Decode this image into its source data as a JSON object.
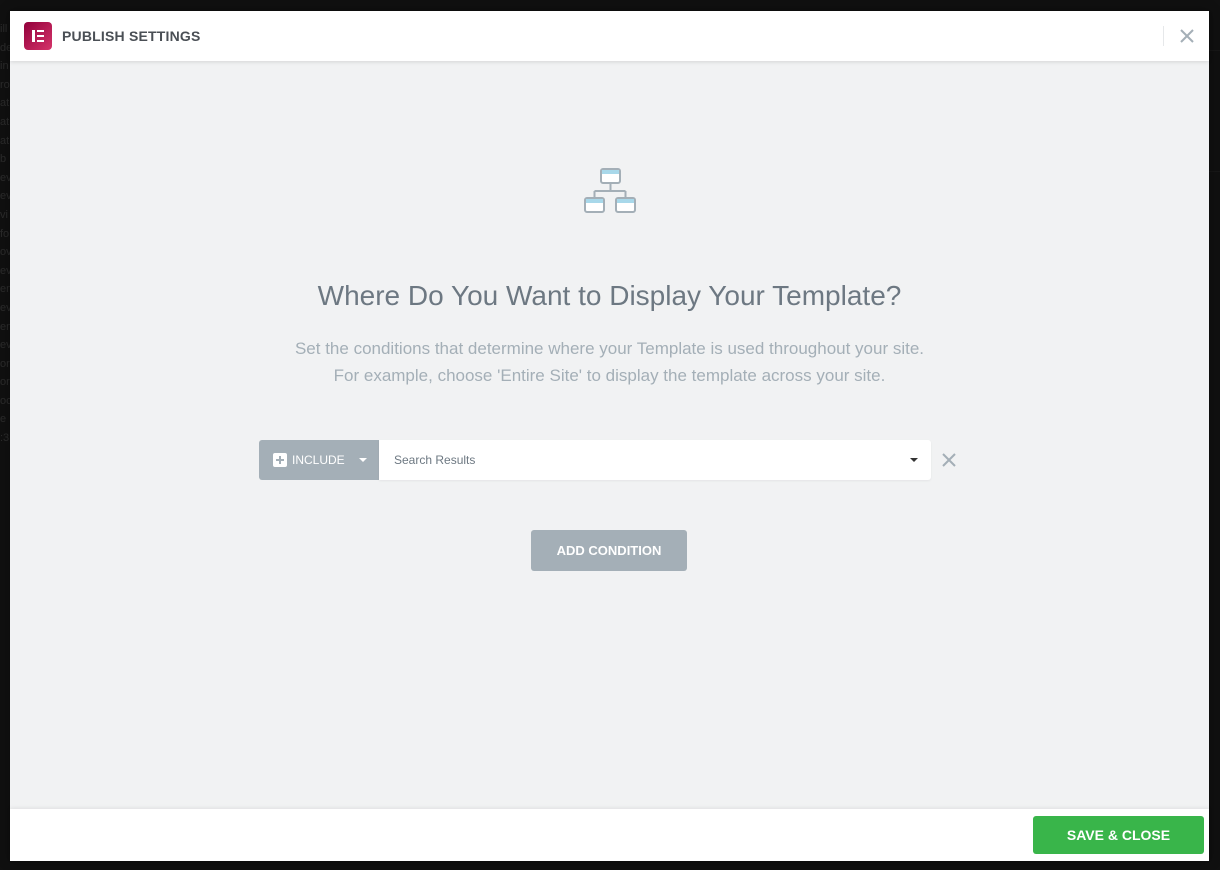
{
  "background_page": {
    "left_fragments": [
      "ill",
      "de",
      "in",
      "ro",
      "at",
      "at",
      "at",
      "b",
      "ev",
      "ev",
      "vi",
      "fo",
      "ov",
      "ev",
      "en",
      "ev",
      "en",
      "ev",
      "or",
      "or",
      "oc",
      "e",
      ":3"
    ]
  },
  "header": {
    "title": "PUBLISH SETTINGS",
    "close_icon": "close-icon"
  },
  "body": {
    "icon": "sitemap-icon",
    "headline": "Where Do You Want to Display Your Template?",
    "description_line1": "Set the conditions that determine where your Template is used throughout your site.",
    "description_line2": "For example, choose 'Entire Site' to display the template across your site."
  },
  "condition": {
    "type_label": "INCLUDE",
    "selected_value": "Search Results"
  },
  "buttons": {
    "add_condition": "ADD CONDITION",
    "save_close": "SAVE & CLOSE"
  },
  "colors": {
    "accent_green": "#39b54a",
    "muted_gray": "#a4afb7",
    "brand_gradient_start": "#92003b",
    "brand_gradient_end": "#d5346a"
  }
}
